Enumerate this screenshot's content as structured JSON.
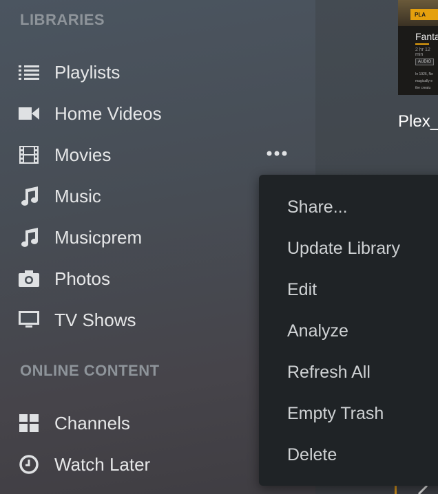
{
  "sidebar": {
    "libraries_header": "LIBRARIES",
    "online_header": "ONLINE CONTENT",
    "items": [
      {
        "label": "Playlists",
        "icon": "list-icon"
      },
      {
        "label": "Home Videos",
        "icon": "video-camera-icon"
      },
      {
        "label": "Movies",
        "icon": "film-icon"
      },
      {
        "label": "Music",
        "icon": "music-note-icon"
      },
      {
        "label": "Musicprem",
        "icon": "music-note-icon"
      },
      {
        "label": "Photos",
        "icon": "camera-icon"
      },
      {
        "label": "TV Shows",
        "icon": "monitor-icon"
      }
    ],
    "online_items": [
      {
        "label": "Channels",
        "icon": "grid-icon"
      },
      {
        "label": "Watch Later",
        "icon": "clock-icon"
      }
    ]
  },
  "context_menu": {
    "items": [
      "Share...",
      "Update Library",
      "Edit",
      "Analyze",
      "Refresh All",
      "Empty Trash",
      "Delete"
    ]
  },
  "poster": {
    "play_label": "PLA",
    "title": "Fanta",
    "meta": "2 hr 12 min",
    "audio_badge": "AUDIO",
    "text": "In 1926, Ne magically e the creatu",
    "caption": "Plex_"
  },
  "colors": {
    "accent": "#e5a00d",
    "menu_bg": "#1f2326",
    "text_primary": "#e6e7e8",
    "text_header": "#8e949a"
  }
}
